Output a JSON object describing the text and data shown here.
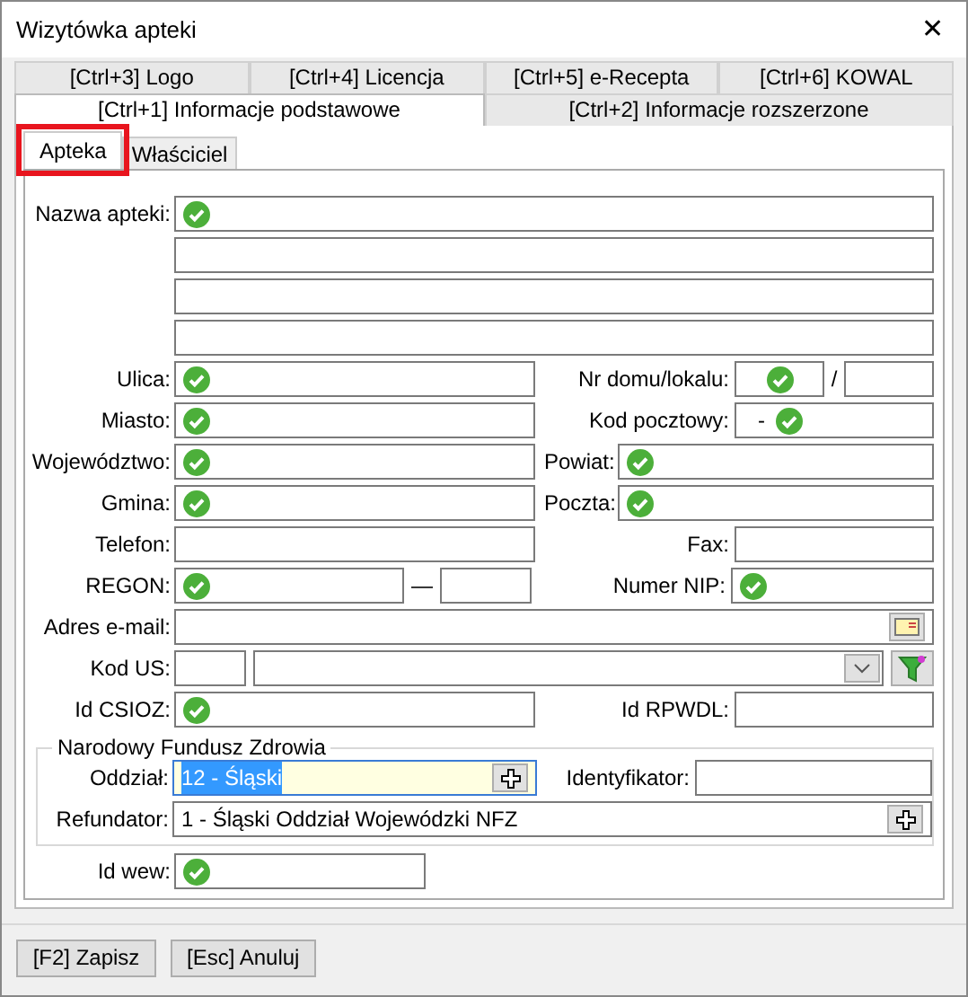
{
  "window": {
    "title": "Wizytówka apteki",
    "close": "✕"
  },
  "tabs_row_1": [
    {
      "label": "[Ctrl+3] Logo",
      "selected": false
    },
    {
      "label": "[Ctrl+4] Licencja",
      "selected": false
    },
    {
      "label": "[Ctrl+5] e-Recepta",
      "selected": false
    },
    {
      "label": "[Ctrl+6] KOWAL",
      "selected": false
    }
  ],
  "tabs_row_2": [
    {
      "label": "[Ctrl+1] Informacje podstawowe",
      "selected": true
    },
    {
      "label": "[Ctrl+2] Informacje rozszerzone",
      "selected": false
    }
  ],
  "subtabs": [
    {
      "label": "Apteka",
      "selected": true,
      "highlighted": true
    },
    {
      "label": "Właściciel",
      "selected": false,
      "highlighted": false
    }
  ],
  "form": {
    "nazwa_apteki": {
      "label": "Nazwa apteki:",
      "lines": [
        {
          "verified": true
        },
        {
          "verified": false
        },
        {
          "verified": false
        },
        {
          "verified": false
        }
      ]
    },
    "ulica": {
      "label": "Ulica:",
      "verified": true
    },
    "nr_domu": {
      "label": "Nr domu/lokalu:",
      "verified": true,
      "separator": "/"
    },
    "miasto": {
      "label": "Miasto:",
      "verified": true
    },
    "kod_pocztowy": {
      "label": "Kod pocztowy:",
      "value": "-",
      "verified": true
    },
    "wojewodztwo": {
      "label": "Województwo:",
      "verified": true
    },
    "powiat": {
      "label": "Powiat:",
      "verified": true
    },
    "gmina": {
      "label": "Gmina:",
      "verified": true
    },
    "poczta": {
      "label": "Poczta:",
      "verified": true
    },
    "telefon": {
      "label": "Telefon:",
      "verified": false
    },
    "fax": {
      "label": "Fax:",
      "verified": false
    },
    "regon": {
      "label": "REGON:",
      "verified": true,
      "separator": "—"
    },
    "numer_nip": {
      "label": "Numer NIP:",
      "verified": true
    },
    "adres_email": {
      "label": "Adres e-mail:",
      "verified": false
    },
    "kod_us": {
      "label": "Kod US:",
      "verified": false
    },
    "id_csioz": {
      "label": "Id CSIOZ:",
      "verified": true
    },
    "id_rpwdl": {
      "label": "Id RPWDL:",
      "verified": false
    },
    "nfz": {
      "title": "Narodowy Fundusz Zdrowia",
      "oddzial": {
        "label": "Oddział:",
        "value": "12 - Śląski",
        "focused": true
      },
      "identyfikator": {
        "label": "Identyfikator:"
      },
      "refundator": {
        "label": "Refundator:",
        "value": "1 - Śląski Oddział Wojewódzki NFZ"
      }
    },
    "id_wew": {
      "label": "Id wew:",
      "verified": true
    }
  },
  "buttons": [
    {
      "label": "[F2] Zapisz"
    },
    {
      "label": "[Esc] Anuluj"
    }
  ]
}
